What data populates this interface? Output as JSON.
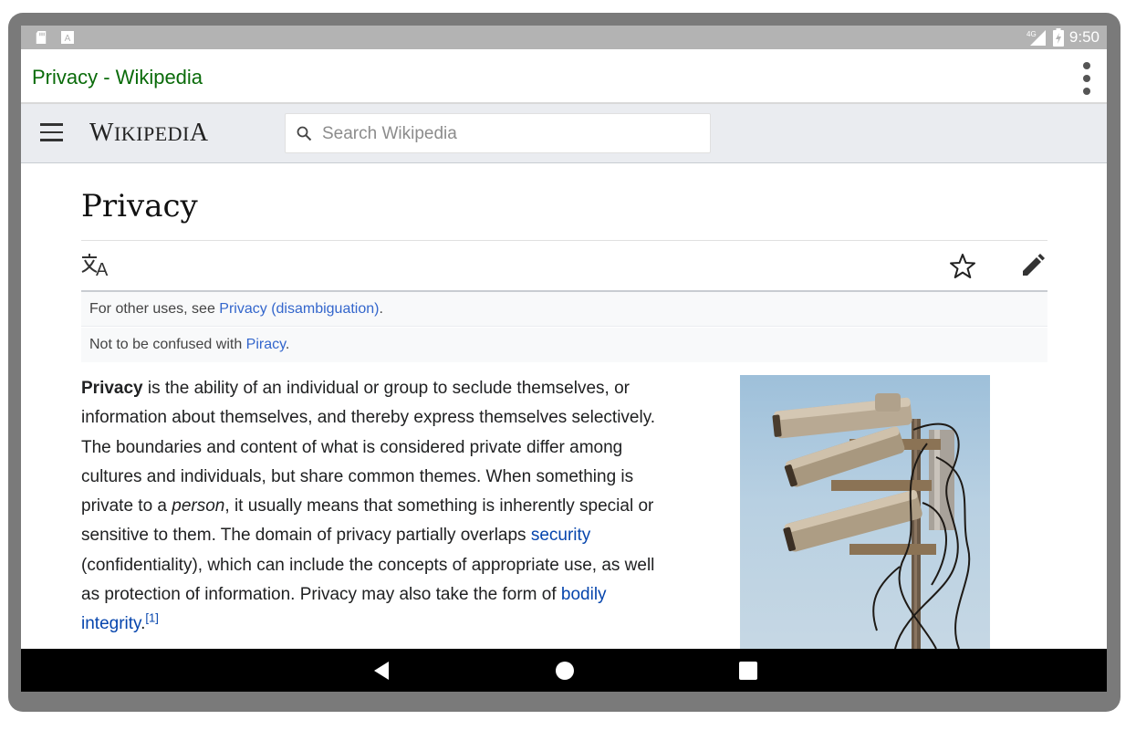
{
  "status_bar": {
    "time": "9:50",
    "network": "4G",
    "left_icons": [
      "sd-card-icon",
      "keyboard-icon"
    ]
  },
  "app_bar": {
    "title": "Privacy - Wikipedia",
    "menu_icon": "overflow-menu-icon"
  },
  "wiki_header": {
    "wordmark_first": "W",
    "wordmark_mid": "IKIPEDI",
    "wordmark_last": "A",
    "search_placeholder": "Search Wikipedia"
  },
  "article": {
    "title": "Privacy",
    "hatnotes": [
      {
        "prefix": "For other uses, see ",
        "link": "Privacy (disambiguation)",
        "suffix": "."
      },
      {
        "prefix": "Not to be confused with ",
        "link": "Piracy",
        "suffix": "."
      }
    ],
    "paragraph": {
      "bold": "Privacy",
      "t1": " is the ability of an individual or group to seclude themselves, or information about themselves, and thereby express themselves selectively. The boundaries and content of what is considered private differ among cultures and individuals, but share common themes. When something is private to a ",
      "italic": "person",
      "t2": ", it usually means that something is inherently special or sensitive to them. The domain of privacy partially overlaps ",
      "link1": "security",
      "t3": " (confidentiality), which can include the concepts of appropriate use, as well as protection of information. Privacy may also take the form of ",
      "link2": "bodily integrity",
      "t4": ".",
      "ref": "[1]"
    },
    "image_subject": "surveillance cameras on a pole"
  },
  "colors": {
    "status_bar": "#b3b3b3",
    "app_title": "#0a6b0a",
    "wiki_header": "#eaecf0",
    "link": "#3366cc",
    "body_link": "#0645ad",
    "nav_bar": "#000000"
  },
  "nav_bar": {
    "buttons": [
      "back-icon",
      "home-icon",
      "recents-icon"
    ]
  }
}
